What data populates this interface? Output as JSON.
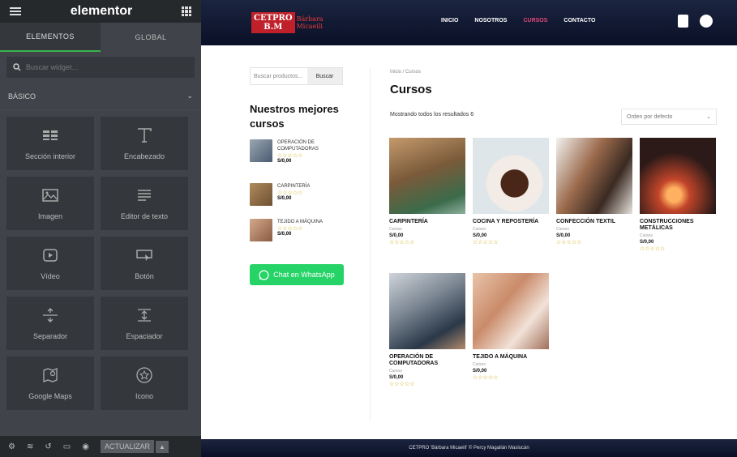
{
  "editor": {
    "logo": "elementor",
    "tabs": [
      "ELEMENTOS",
      "GLOBAL"
    ],
    "search_placeholder": "Buscar widget...",
    "section_label": "BÁSICO",
    "widgets": [
      {
        "label": "Sección interior",
        "icon": "columns-icon"
      },
      {
        "label": "Encabezado",
        "icon": "heading-icon"
      },
      {
        "label": "Imagen",
        "icon": "image-icon"
      },
      {
        "label": "Editor de texto",
        "icon": "text-editor-icon"
      },
      {
        "label": "Vídeo",
        "icon": "video-icon"
      },
      {
        "label": "Botón",
        "icon": "button-icon"
      },
      {
        "label": "Separador",
        "icon": "divider-icon"
      },
      {
        "label": "Espaciador",
        "icon": "spacer-icon"
      },
      {
        "label": "Google Maps",
        "icon": "map-icon"
      },
      {
        "label": "Icono",
        "icon": "star-icon"
      }
    ],
    "update_label": "ACTUALIZAR"
  },
  "site": {
    "logo_main": "CETPRO",
    "logo_sub": "B.M",
    "logo_name": "Bárbara Micaeili",
    "nav": [
      "INICIO",
      "NOSOTROS",
      "CURSOS",
      "CONTACTO"
    ],
    "active_nav": "CURSOS",
    "search_placeholder": "Buscar productos...",
    "search_button": "Buscar",
    "best_title": "Nuestros mejores cursos",
    "best_products": [
      {
        "name": "OPERACIÓN DE COMPUTADORAS",
        "price": "S/0,00"
      },
      {
        "name": "CARPINTERÍA",
        "price": "S/0,00"
      },
      {
        "name": "TEJIDO A MÁQUINA",
        "price": "S/0,00"
      }
    ],
    "whatsapp_label": "Chat en WhatsApp",
    "breadcrumb": "Inicio / Cursos",
    "page_title": "Cursos",
    "result_count": "Mostrando todos los resultados 6",
    "sort_label": "Orden por defecto",
    "products": [
      {
        "name": "CARPINTERÍA",
        "category": "Cursos",
        "price": "S/0,00"
      },
      {
        "name": "COCINA Y REPOSTERÍA",
        "category": "Cursos",
        "price": "S/0,00"
      },
      {
        "name": "CONFECCIÓN TEXTIL",
        "category": "Cursos",
        "price": "S/0,00"
      },
      {
        "name": "CONSTRUCCIONES METÁLICAS",
        "category": "Cursos",
        "price": "S/0,00"
      },
      {
        "name": "OPERACIÓN DE COMPUTADORAS",
        "category": "Cursos",
        "price": "S/0,00"
      },
      {
        "name": "TEJIDO A MÁQUINA",
        "category": "Cursos",
        "price": "S/0,00"
      }
    ],
    "stars": "☆☆☆☆☆",
    "footer": "CETPRO 'Bárbara Micaeili' © Percy Magallán Maslucán"
  }
}
